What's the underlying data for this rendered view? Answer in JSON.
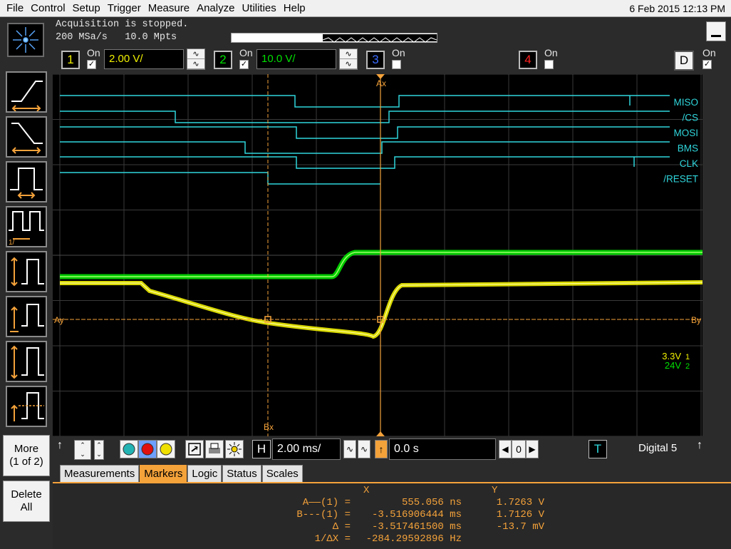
{
  "menu": {
    "items": [
      "File",
      "Control",
      "Setup",
      "Trigger",
      "Measure",
      "Analyze",
      "Utilities",
      "Help"
    ],
    "clock": "6 Feb 2015 12:13 PM"
  },
  "acquisition": {
    "status": "Acquisition is stopped.",
    "sample_rate": "200 MSa/s",
    "memory_depth": "10.0 Mpts"
  },
  "channels": [
    {
      "num": "1",
      "on_label": "On",
      "enabled": true,
      "scale": "2.00 V/",
      "color": "#f0f000"
    },
    {
      "num": "2",
      "on_label": "On",
      "enabled": true,
      "scale": "10.0 V/",
      "color": "#00e000"
    },
    {
      "num": "3",
      "on_label": "On",
      "enabled": false,
      "color": "#3a6cff"
    },
    {
      "num": "4",
      "on_label": "On",
      "enabled": false,
      "color": "#ff2020"
    },
    {
      "num": "D",
      "on_label": "On",
      "enabled": true,
      "color": "#000000"
    }
  ],
  "digital_labels": [
    {
      "name": "MISO",
      "bit": "0"
    },
    {
      "name": "/CS",
      "bit": "1"
    },
    {
      "name": "MOSI",
      "bit": "3"
    },
    {
      "name": "BMS",
      "bit": "2"
    },
    {
      "name": "CLK",
      "bit": "4"
    },
    {
      "name": "/RESET",
      "bit": "5"
    }
  ],
  "markers_overlay": {
    "ax": "Ax",
    "bx": "Bx",
    "ay": "Ay",
    "by": "By",
    "offset1": "3.3V",
    "offset2": "24V",
    "offset1_tag": "1",
    "offset2_tag": "2"
  },
  "left_panel": {
    "more_line1": "More",
    "more_line2": "(1 of 2)",
    "delete_line1": "Delete",
    "delete_line2": "All"
  },
  "controls": {
    "timebase_label": "H",
    "timebase": "2.00 ms/",
    "delay": "0.0 s",
    "delay_ref": "0",
    "trigger_label": "T",
    "trigger_source": "Digital 5"
  },
  "tabs": [
    "Measurements",
    "Markers",
    "Logic",
    "Status",
    "Scales"
  ],
  "active_tab": "Markers",
  "marker_table": {
    "col_x": "X",
    "col_y": "Y",
    "rows": [
      {
        "label": "A——(1) =",
        "x": "555.056 ns",
        "y": "1.7263 V"
      },
      {
        "label": "B---(1) =",
        "x": "-3.516906444 ms",
        "y": "1.7126 V"
      },
      {
        "label": "Δ =",
        "x": "-3.517461500 ms",
        "y": "-13.7 mV"
      },
      {
        "label": "1/ΔX =",
        "x": "-284.29592896 Hz",
        "y": ""
      }
    ]
  },
  "colors": {
    "digital": "#2fd6dc",
    "ch1": "#f0f000",
    "ch2": "#00e000",
    "marker": "#f4a23a",
    "grid": "#3a3a3a"
  }
}
